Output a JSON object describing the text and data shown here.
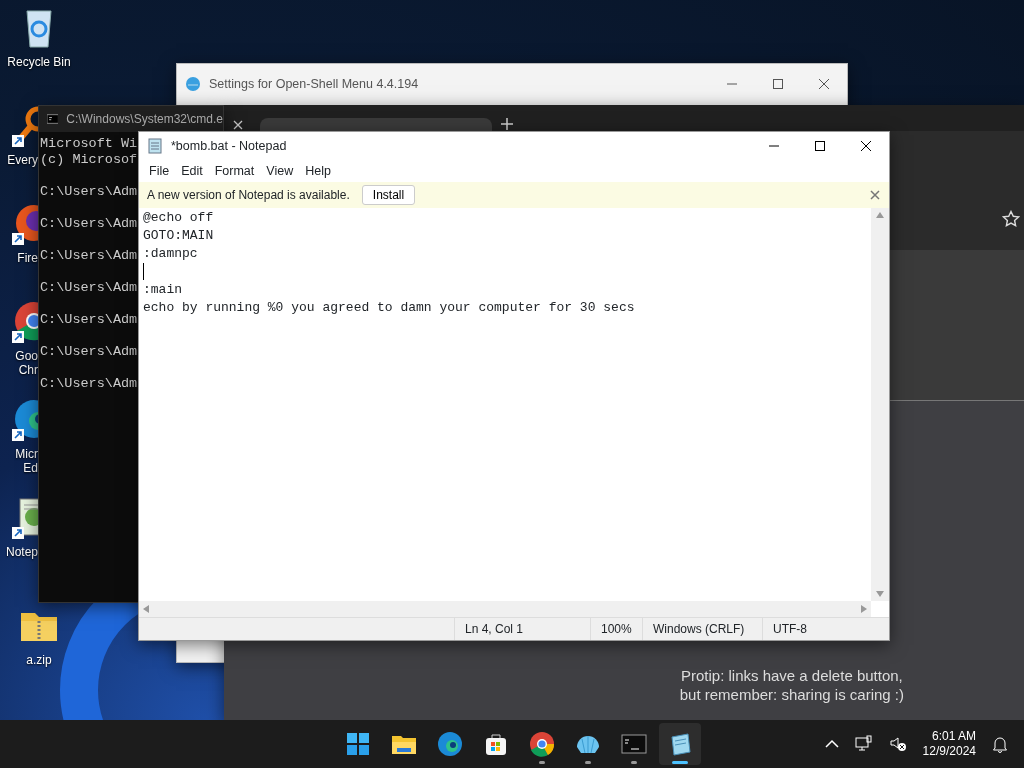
{
  "desktop_icons": [
    {
      "kind": "recycle",
      "lines": [
        "Recycle Bin"
      ],
      "shortcut": false
    },
    {
      "kind": "search",
      "lines": [
        "Every"
      ],
      "shortcut": true
    },
    {
      "kind": "firefox",
      "lines": [
        "Fire"
      ],
      "shortcut": true
    },
    {
      "kind": "chrome",
      "lines": [
        "Goo",
        "Chr"
      ],
      "shortcut": true
    },
    {
      "kind": "edge",
      "lines": [
        "Micr",
        "Ed"
      ],
      "shortcut": true
    },
    {
      "kind": "notepad",
      "lines": [
        "Notep"
      ],
      "shortcut": true
    },
    {
      "kind": "zip",
      "lines": [
        "a.zip"
      ],
      "shortcut": false
    }
  ],
  "settings_window": {
    "title": "Settings for Open-Shell Menu 4.4.194"
  },
  "cmd_window": {
    "title": "C:\\Windows\\System32\\cmd.e",
    "header": [
      "Microsoft Wi",
      "(c) Microsof"
    ],
    "prompts": [
      "C:\\Users\\Adm",
      "C:\\Users\\Adm",
      "C:\\Users\\Adm",
      "C:\\Users\\Adm",
      "C:\\Users\\Adm",
      "C:\\Users\\Adm",
      "C:\\Users\\Adm"
    ]
  },
  "browser": {
    "protip": [
      "Protip: links have a delete button,",
      "but remember: sharing is caring :)"
    ]
  },
  "notepad": {
    "title": "*bomb.bat - Notepad",
    "menu": [
      "File",
      "Edit",
      "Format",
      "View",
      "Help"
    ],
    "banner": {
      "text": "A new version of Notepad is available.",
      "button": "Install"
    },
    "lines": [
      {
        "text": "@echo off",
        "cursor": false
      },
      {
        "text": "GOTO:MAIN",
        "cursor": false
      },
      {
        "text": ":damnpc",
        "cursor": false
      },
      {
        "cursor": true
      },
      {
        "text": ":main",
        "cursor": false
      },
      {
        "text": "echo by running %0 you agreed to damn your computer for 30 secs",
        "cursor": false
      }
    ],
    "status": [
      "Ln 4, Col 1",
      "100%",
      "Windows (CRLF)",
      "UTF-8"
    ]
  },
  "taskbar": {
    "apps": [
      {
        "kind": "start",
        "running": false,
        "selected": false
      },
      {
        "kind": "explorer",
        "running": false,
        "selected": false
      },
      {
        "kind": "edge",
        "running": false,
        "selected": false
      },
      {
        "kind": "store",
        "running": false,
        "selected": false
      },
      {
        "kind": "chrome",
        "running": true,
        "selected": false
      },
      {
        "kind": "shell",
        "running": true,
        "selected": false
      },
      {
        "kind": "cmd",
        "running": true,
        "selected": false
      },
      {
        "kind": "notepad",
        "running": true,
        "selected": true
      }
    ],
    "time": "6:01 AM",
    "date": "12/9/2024"
  }
}
